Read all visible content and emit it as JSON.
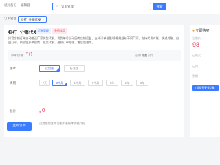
{
  "topbar": {
    "nav_item_1": "就好备份",
    "nav_item_2": "编辑器",
    "search_placeholder": "订单管理",
    "search_button": "搜索"
  },
  "tabs": {
    "inactive_label": "订单管理",
    "active_label": "抖打_分销代发"
  },
  "product": {
    "title": "抖打_分销代发",
    "tag_primary": "订单管理",
    "tag_secondary": "免费试用",
    "description": "抖音店铺订单自动推送厂家供货代发，发货单号自动回传店铺后台。支持订单批量/规格推送给不同厂家，支持代发对账、快递对账、自由打印、供应链多供应商、批文代发、退款订单处理、售后管理等。",
    "price_label": "参考价格",
    "price_currency": "¥",
    "price_value": "0",
    "price_note_prefix": "获赠",
    "price_note_value": "免费",
    "price_note_suffix": "试用"
  },
  "version": {
    "label": "版本",
    "options": [
      "试用版",
      "标准版"
    ],
    "selected": 0
  },
  "period": {
    "label": "周期",
    "options": [
      "7天",
      "3个月",
      "1个月",
      "6个月",
      "1年",
      "2年",
      "3年"
    ],
    "selected": 1
  },
  "total": {
    "label": "总价",
    "currency": "¥",
    "value": "0"
  },
  "intro": {
    "label": "简介",
    "text": "试用版包含的功能和表版本功能介绍"
  },
  "buy_button": "立即订购",
  "sidebar": {
    "header": "立即购买",
    "line1": "当前价",
    "big_value": "98",
    "line2": "已购买",
    "line3": "已用",
    "line4": "到期",
    "button": "立即续费更多功能"
  }
}
